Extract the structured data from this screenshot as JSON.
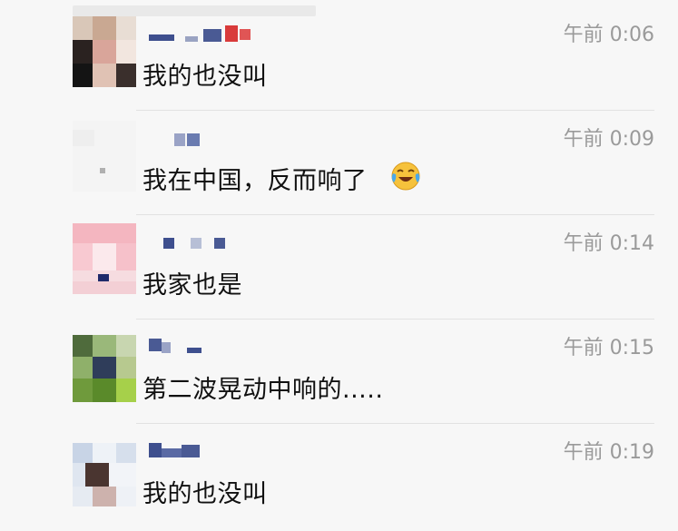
{
  "comments": [
    {
      "time": "午前 0:06",
      "text": "我的也没叫"
    },
    {
      "time": "午前 0:09",
      "text": "我在中国，反而响了",
      "emoji": "laughing-crying-emoji"
    },
    {
      "time": "午前 0:14",
      "text": "我家也是"
    },
    {
      "time": "午前 0:15",
      "text": "第二波晃动中响的....."
    },
    {
      "time": "午前 0:19",
      "text": "我的也没叫"
    }
  ],
  "colors": {
    "background": "#f7f7f7",
    "text": "#111111",
    "time": "#9a9a9a",
    "divider": "#e2e2e2",
    "nickname_blur": "#3a4f8a"
  },
  "icons": [
    "avatar-image",
    "nickname-mosaic",
    "laughing-crying-emoji"
  ]
}
